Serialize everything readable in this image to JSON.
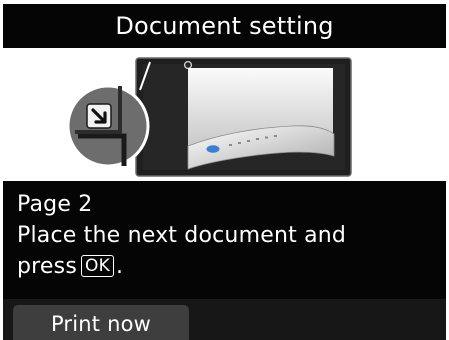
{
  "screen": {
    "title": "Document setting"
  },
  "message": {
    "line1": "Page 2",
    "line2": "Place the next document and",
    "line3_prefix": "press",
    "ok_key_label": "OK",
    "line3_suffix": "."
  },
  "softkeys": {
    "left_label": "Print now"
  },
  "illustration": {
    "icons": [
      "document-corner-alignment-icon",
      "document-on-glass-icon"
    ]
  },
  "colors": {
    "panel_bg": "#050505",
    "softkey_bg": "#3e3e3e",
    "glass_bg": "#1f1f1f",
    "accent_blue": "#3a7fd0"
  }
}
